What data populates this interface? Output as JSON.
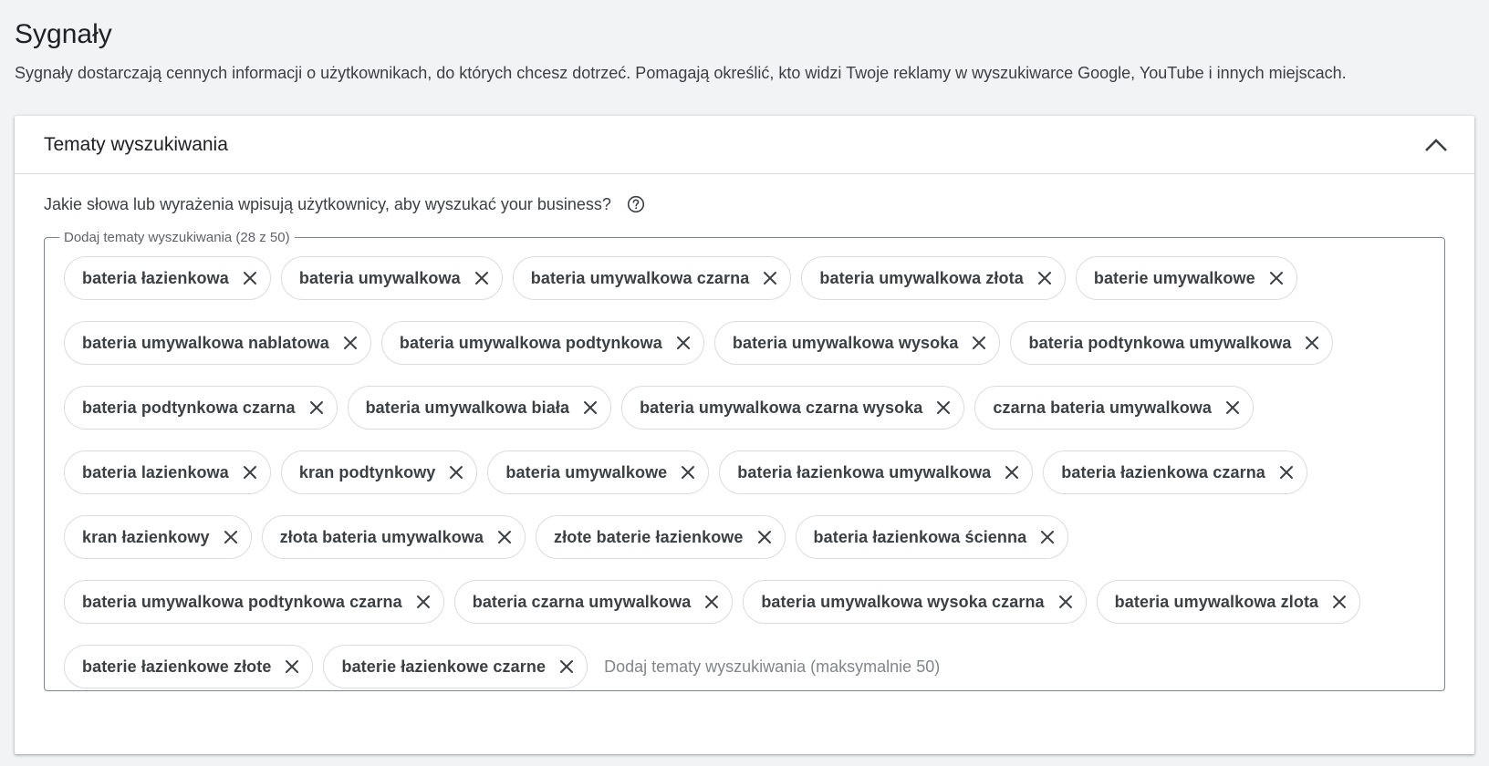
{
  "page": {
    "title": "Sygnały",
    "description": "Sygnały dostarczają cennych informacji o użytkownikach, do których chcesz dotrzeć. Pomagają określić, kto widzi Twoje reklamy w wyszukiwarce Google, YouTube i innych miejscach."
  },
  "section": {
    "title": "Tematy wyszukiwania",
    "collapse_icon": "chevron-up-icon",
    "question": "Jakie słowa lub wyrażenia wpisują użytkownicy, aby wyszukać your business?",
    "help_icon": "help-circle-icon",
    "field_label": "Dodaj tematy wyszukiwania (28 z 50)",
    "input_placeholder": "Dodaj tematy wyszukiwania (maksymalnie 50)",
    "topics": [
      "bateria łazienkowa",
      "bateria umywalkowa",
      "bateria umywalkowa czarna",
      "bateria umywalkowa złota",
      "baterie umywalkowe",
      "bateria umywalkowa nablatowa",
      "bateria umywalkowa podtynkowa",
      "bateria umywalkowa wysoka",
      "bateria podtynkowa umywalkowa",
      "bateria podtynkowa czarna",
      "bateria umywalkowa biała",
      "bateria umywalkowa czarna wysoka",
      "czarna bateria umywalkowa",
      "bateria lazienkowa",
      "kran podtynkowy",
      "bateria umywalkowe",
      "bateria łazienkowa umywalkowa",
      "bateria łazienkowa czarna",
      "kran łazienkowy",
      "złota bateria umywalkowa",
      "złote baterie łazienkowe",
      "bateria łazienkowa ścienna",
      "bateria umywalkowa podtynkowa czarna",
      "bateria czarna umywalkowa",
      "bateria umywalkowa wysoka czarna",
      "bateria umywalkowa zlota",
      "baterie łazienkowe złote",
      "baterie łazienkowe czarne"
    ],
    "chip_remove_icon": "close-icon"
  }
}
